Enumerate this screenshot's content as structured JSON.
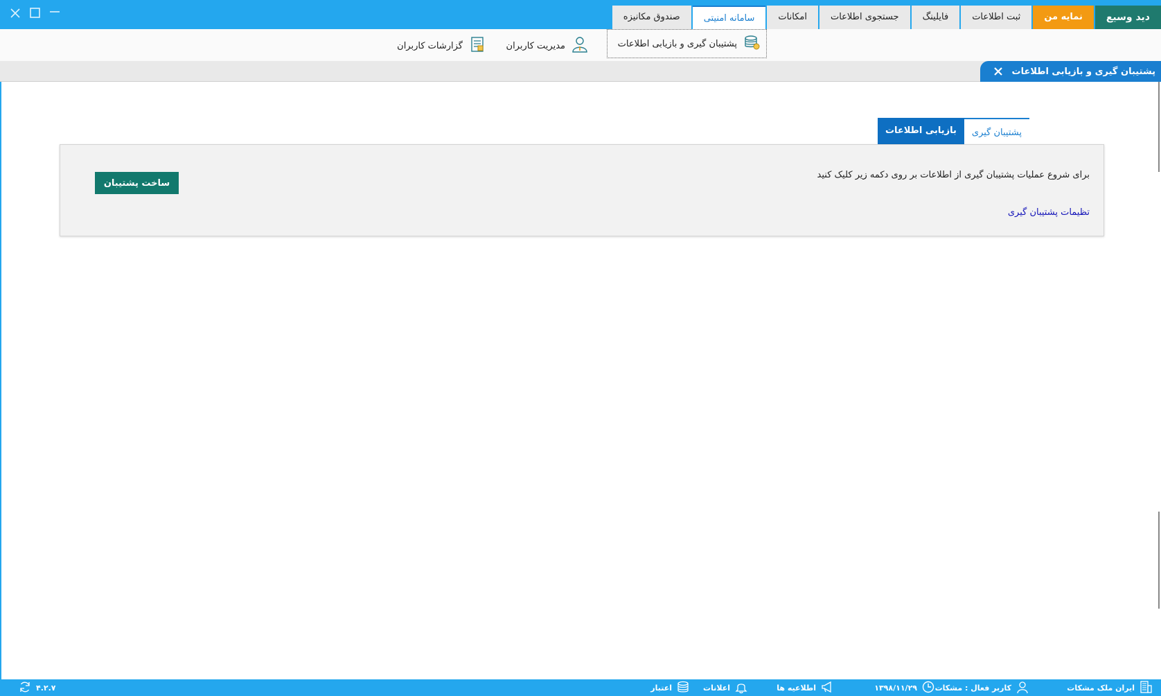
{
  "window": {
    "close_icon": "close-icon",
    "maximize_icon": "maximize-icon",
    "minimize_icon": "minimize-icon"
  },
  "tabs": [
    {
      "label": "دید وسیع",
      "style": "green"
    },
    {
      "label": "نمایه من",
      "style": "orange"
    },
    {
      "label": "ثبت اطلاعات",
      "style": "normal"
    },
    {
      "label": "فایلینگ",
      "style": "normal"
    },
    {
      "label": "جستجوی اطلاعات",
      "style": "normal"
    },
    {
      "label": "امکانات",
      "style": "normal"
    },
    {
      "label": "سامانه امنیتی",
      "style": "active"
    },
    {
      "label": "صندوق مکانیزه",
      "style": "normal"
    }
  ],
  "ribbon": {
    "backup": {
      "label": "پشتیبان گیری و بازیابی اطلاعات",
      "icon": "database-icon"
    },
    "users": {
      "label": "مدیریت کاربران",
      "icon": "user-icon"
    },
    "reports": {
      "label": "گزارشات کاربران",
      "icon": "report-icon"
    }
  },
  "doc_tab": {
    "title": "پشتیبان گیری و بازیابی اطلاعات"
  },
  "inner_tabs": {
    "backup": "پشتیبان گیری",
    "restore": "بازیابی اطلاعات"
  },
  "panel": {
    "message": "برای شروع عملیات پشتیبان گیری از اطلاعات بر روی دکمه زیر کلیک کنید",
    "settings_link": "تظیمات پشتیبان گیری",
    "create_button": "ساخت پشتیبان"
  },
  "statusbar": {
    "company": "ایران ملک مشکات",
    "active_user": "کاربر فعال : مشکات",
    "date": "۱۳۹۸/۱۱/۲۹",
    "announcements": "اطلاعیه ها",
    "notifications": "اعلانات",
    "credit": "اعتبار",
    "version": "۴.۲.۷"
  },
  "colors": {
    "topbar": "#24a7ee",
    "accent": "#1a7fd0",
    "green_tab": "#1f7a6e",
    "orange_tab": "#f39a12",
    "button": "#12796d",
    "link": "#1212b8"
  }
}
